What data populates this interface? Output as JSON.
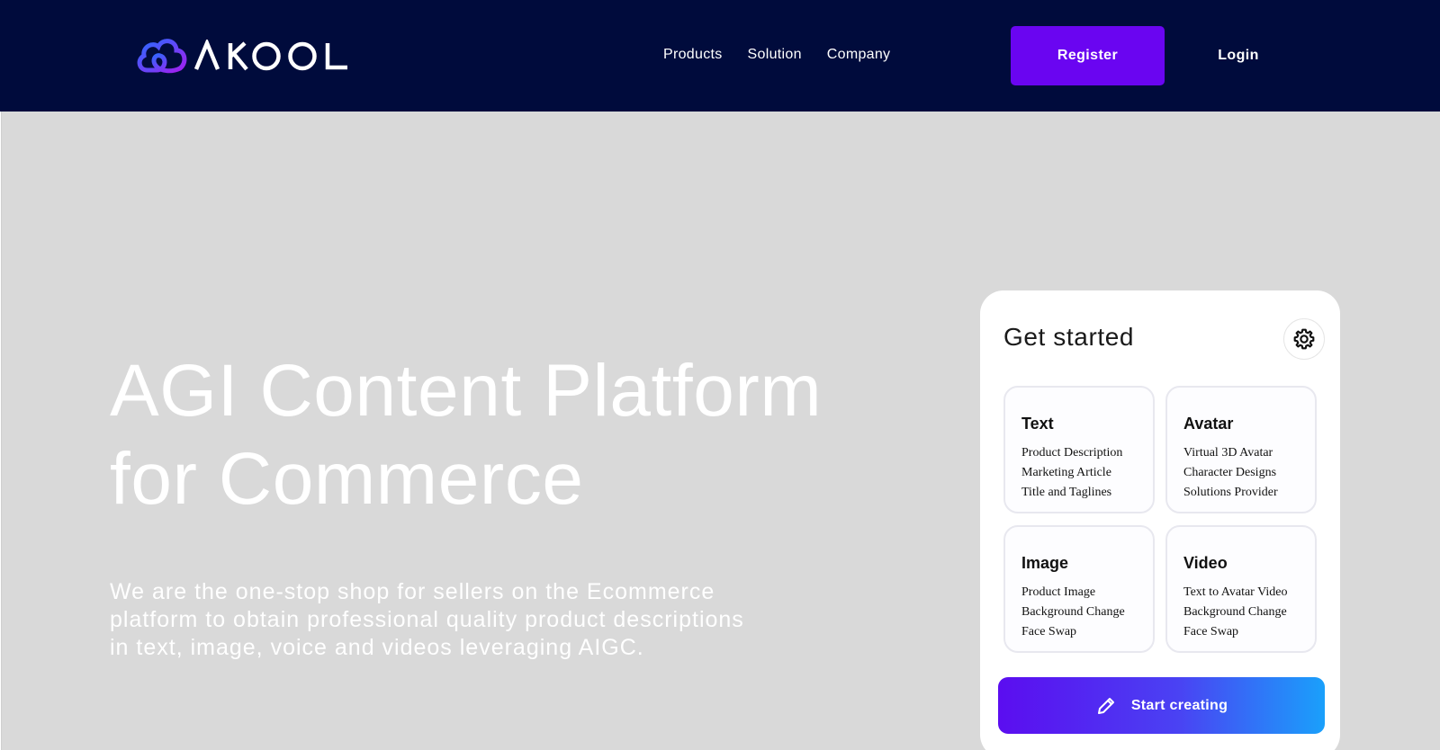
{
  "brand": {
    "logo_text": "AKOOL",
    "gradient_start": "#2a6bff",
    "gradient_end": "#a020f0"
  },
  "header": {
    "background": "#000b3c",
    "nav": [
      {
        "label": "Products"
      },
      {
        "label": "Solution"
      },
      {
        "label": "Company"
      }
    ],
    "register_label": "Register",
    "login_label": "Login",
    "register_color": "#6a05f1"
  },
  "hero": {
    "title_lines": [
      "AGI Content Platform",
      "for Commerce"
    ],
    "description": "We are the one-stop shop for sellers on the Ecommerce platform to obtain professional quality product descriptions in text, image, voice and videos leveraging AIGC.",
    "background": "#d9d9d9"
  },
  "card": {
    "title": "Get started",
    "settings_icon": "gear-icon",
    "tiles": [
      {
        "title": "Text",
        "items": [
          "Product Description",
          "Marketing Article",
          "Title and Taglines"
        ]
      },
      {
        "title": "Avatar",
        "items": [
          "Virtual 3D Avatar",
          "Character Designs",
          "Solutions Provider"
        ]
      },
      {
        "title": "Image",
        "items": [
          "Product Image",
          "Background Change",
          "Face Swap"
        ]
      },
      {
        "title": "Video",
        "items": [
          "Text to Avatar Video",
          "Background Change",
          "Face Swap"
        ]
      }
    ],
    "start_label": "Start creating",
    "start_icon": "pencil-icon"
  }
}
